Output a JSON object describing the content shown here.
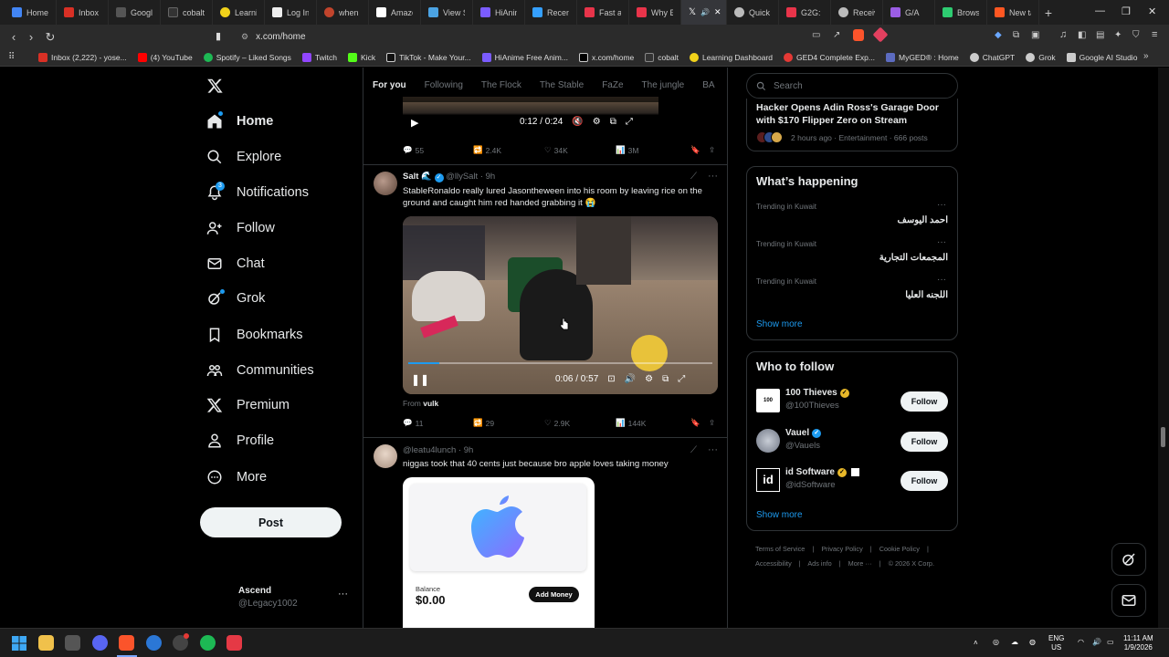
{
  "browser": {
    "tabs": [
      {
        "label": "Home",
        "color": "#4285f4"
      },
      {
        "label": "Inbox",
        "color": "#d93025"
      },
      {
        "label": "Google",
        "color": "#555555"
      },
      {
        "label": "cobalt",
        "color": "#333333"
      },
      {
        "label": "Learni",
        "color": "#f1d21a"
      },
      {
        "label": "Log In",
        "color": "#eeeeee"
      },
      {
        "label": "when c",
        "color": "#c1442c"
      },
      {
        "label": "Amazo",
        "color": "#ffffff"
      },
      {
        "label": "View S",
        "color": "#4ba3e3"
      },
      {
        "label": "HiAnim",
        "color": "#7b5cff"
      },
      {
        "label": "Recent",
        "color": "#35a0ff"
      },
      {
        "label": "Fast ar",
        "color": "#e8344a"
      },
      {
        "label": "Why E",
        "color": "#e8344a"
      },
      {
        "label": "",
        "color": "#ffffff",
        "active": true
      },
      {
        "label": "Quick",
        "color": "#bbbbbb"
      },
      {
        "label": "G2G: V",
        "color": "#e8344a"
      },
      {
        "label": "Receiv",
        "color": "#bbbbbb"
      },
      {
        "label": "G/A",
        "color": "#9b5de5"
      },
      {
        "label": "Brows",
        "color": "#2ecc71"
      },
      {
        "label": "New ta",
        "color": "#ff5722"
      }
    ],
    "new_tab": "+",
    "url": "x.com/home",
    "bookmarks": [
      {
        "label": "Inbox (2,222) - yose...",
        "color": "#d93025"
      },
      {
        "label": "(4) YouTube",
        "color": "#ff0000"
      },
      {
        "label": "Spotify – Liked Songs",
        "color": "#1db954"
      },
      {
        "label": "Twitch",
        "color": "#9146ff"
      },
      {
        "label": "Kick",
        "color": "#53fc18"
      },
      {
        "label": "TikTok - Make Your...",
        "color": "#ffffff"
      },
      {
        "label": "HiAnime Free Anim...",
        "color": "#7b5cff"
      },
      {
        "label": "x.com/home",
        "color": "#ffffff"
      },
      {
        "label": "cobalt",
        "color": "#333333"
      },
      {
        "label": "Learning Dashboard",
        "color": "#f1d21a"
      },
      {
        "label": "GED4 Complete Exp...",
        "color": "#e53935"
      },
      {
        "label": "MyGED® : Home",
        "color": "#5c6bc0"
      },
      {
        "label": "ChatGPT",
        "color": "#cccccc"
      },
      {
        "label": "Grok",
        "color": "#cccccc"
      },
      {
        "label": "Google AI Studio",
        "color": "#cccccc"
      }
    ]
  },
  "sidebar": {
    "items": [
      {
        "label": "Home"
      },
      {
        "label": "Explore"
      },
      {
        "label": "Notifications",
        "badge": "3"
      },
      {
        "label": "Follow"
      },
      {
        "label": "Chat"
      },
      {
        "label": "Grok"
      },
      {
        "label": "Bookmarks"
      },
      {
        "label": "Communities"
      },
      {
        "label": "Premium"
      },
      {
        "label": "Profile"
      },
      {
        "label": "More"
      }
    ],
    "post_label": "Post",
    "account": {
      "name": "Ascend",
      "handle": "@Legacy1002",
      "menu": "···"
    }
  },
  "feed": {
    "tabs": [
      "For you",
      "Following",
      "The Flock",
      "The Stable",
      "FaZe",
      "The jungle",
      "BA"
    ],
    "tweet0": {
      "video_time": "0:12 / 0:24",
      "replies": "55",
      "reposts": "2.4K",
      "likes": "34K",
      "views": "3M"
    },
    "tweet1": {
      "name": "Salt",
      "emoji": "🌊",
      "handle": "@llySalt",
      "time": "· 9h",
      "text": "StableRonaldo really lured Jasontheween into his room by leaving rice on the ground and caught him red handed grabbing it 😭",
      "video_time": "0:06 / 0:57",
      "from_label": "From",
      "from_user": "vulk",
      "replies": "11",
      "reposts": "29",
      "likes": "2.9K",
      "views": "144K"
    },
    "tweet2": {
      "handle": "@leatu4lunch",
      "time": "· 9h",
      "text": "niggas took that 40 cents just because bro apple loves taking money",
      "balance_label": "Balance",
      "balance_value": "$0.00",
      "add_money": "Add Money"
    }
  },
  "right": {
    "search_placeholder": "Search",
    "news": {
      "headline": "Hacker Opens Adin Ross's Garage Door with $170 Flipper Zero on Stream",
      "meta": "2 hours ago · Entertainment · 666 posts"
    },
    "happening": {
      "title": "What’s happening",
      "trends": [
        {
          "context": "Trending in Kuwait",
          "name": "احمد اليوسف"
        },
        {
          "context": "Trending in Kuwait",
          "name": "المجمعات التجارية"
        },
        {
          "context": "Trending in Kuwait",
          "name": "اللجنه العليا"
        }
      ],
      "show_more": "Show more"
    },
    "who_to_follow": {
      "title": "Who to follow",
      "users": [
        {
          "name": "100 Thieves",
          "handle": "@100Thieves",
          "badge": "gold"
        },
        {
          "name": "Vauel",
          "handle": "@Vauels",
          "badge": "blue"
        },
        {
          "name": "id Software",
          "handle": "@idSoftware",
          "badge": "gold"
        }
      ],
      "follow_label": "Follow",
      "show_more": "Show more"
    },
    "footer": {
      "line1": [
        "Terms of Service",
        "Privacy Policy",
        "Cookie Policy"
      ],
      "line2": [
        "Accessibility",
        "Ads info",
        "More ···",
        "© 2026 X Corp."
      ]
    }
  },
  "taskbar": {
    "lang": "ENG",
    "region": "US",
    "time": "11:11 AM",
    "date": "1/9/2026"
  },
  "colors": {
    "accent": "#1d9bf0",
    "background": "#000000",
    "border": "#2f3336"
  }
}
